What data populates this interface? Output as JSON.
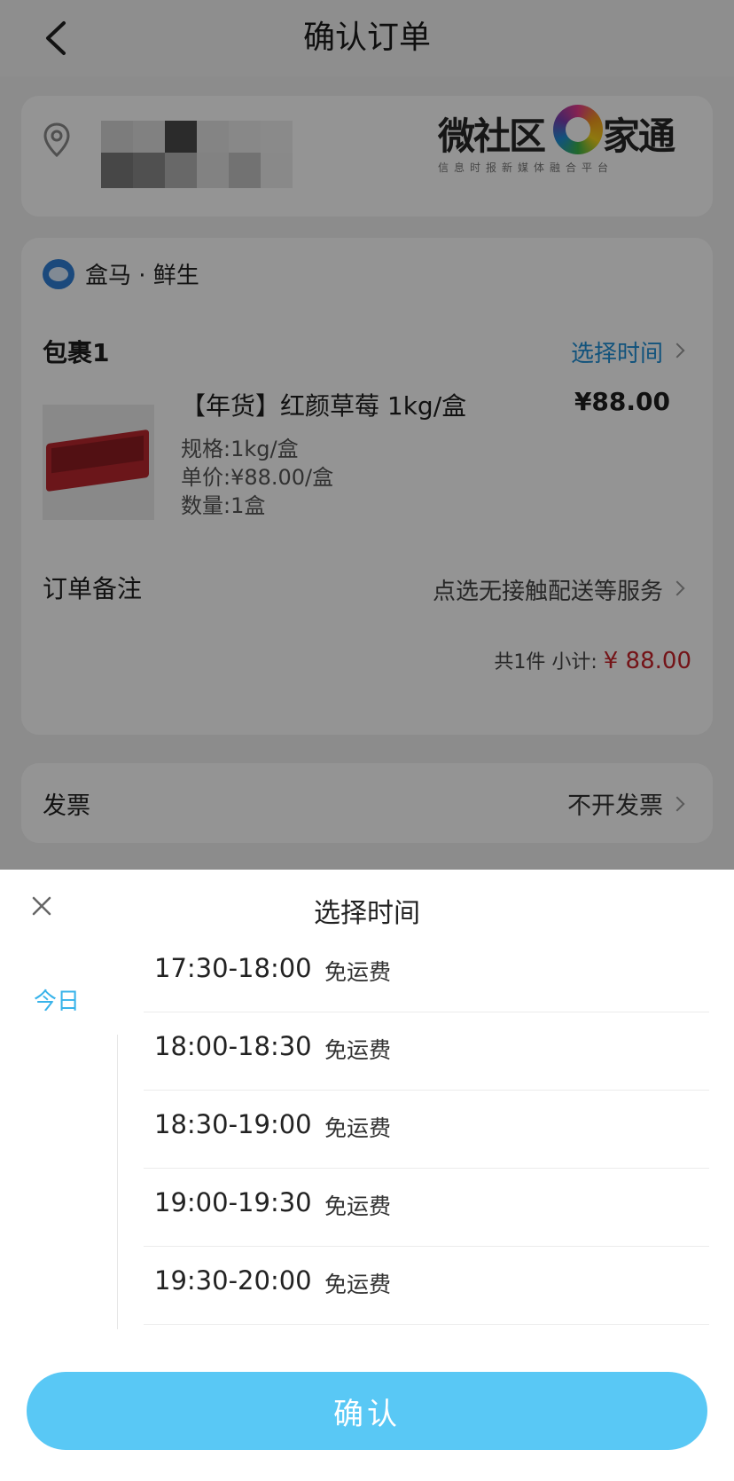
{
  "nav": {
    "title": "确认订单"
  },
  "address": {
    "logo": {
      "text_left": "微社区",
      "text_right": "家通",
      "subtitle": "信息时报新媒体融合平台"
    }
  },
  "order": {
    "store": "盒马 · 鲜生",
    "package": {
      "label": "包裹1",
      "pick_time": "选择时间"
    },
    "product": {
      "name": "【年货】红颜草莓 1kg/盒",
      "price": "¥88.00",
      "spec": "规格:1kg/盒",
      "unit_price": "单价:¥88.00/盒",
      "quantity": "数量:1盒"
    },
    "remark": {
      "label": "订单备注",
      "value": "点选无接触配送等服务"
    },
    "subtotal": {
      "count": "共1件",
      "label": "小计:",
      "amount": "¥ 88.00"
    }
  },
  "invoice": {
    "label": "发票",
    "value": "不开发票"
  },
  "sheet": {
    "title": "选择时间",
    "day": "今日",
    "slots": [
      {
        "time": "17:30-18:00",
        "fee": "免运费"
      },
      {
        "time": "18:00-18:30",
        "fee": "免运费"
      },
      {
        "time": "18:30-19:00",
        "fee": "免运费"
      },
      {
        "time": "19:00-19:30",
        "fee": "免运费"
      },
      {
        "time": "19:30-20:00",
        "fee": "免运费"
      }
    ],
    "confirm": "确认"
  },
  "colors": {
    "accent": "#38b3ea",
    "button": "#59c8f5",
    "price_red": "#c8232a",
    "link_blue": "#1f8fd6"
  }
}
